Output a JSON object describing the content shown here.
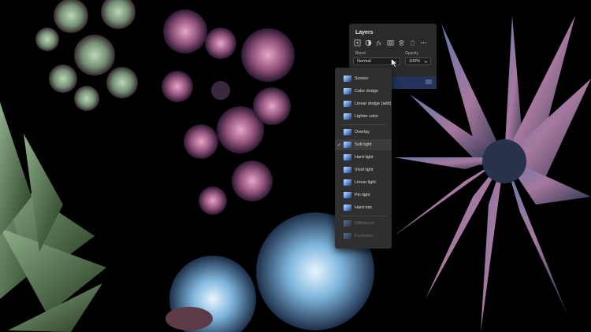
{
  "panel": {
    "title": "Layers",
    "blend_label": "Blend",
    "blend_value": "Normal",
    "opacity_label": "Opacity",
    "opacity_value": "100%",
    "toolbar_icons": [
      "add-layer-icon",
      "adjustment-icon",
      "fx-icon",
      "mask-icon",
      "layer-stack-icon",
      "delete-icon",
      "more-icon"
    ]
  },
  "blend_menu": {
    "items": [
      {
        "label": "Screen"
      },
      {
        "label": "Color dodge"
      },
      {
        "label": "Linear dodge (add)"
      },
      {
        "label": "Lighter color"
      },
      {
        "label": "Overlay"
      },
      {
        "label": "Soft light",
        "selected": true
      },
      {
        "label": "Hard light"
      },
      {
        "label": "Vivid light"
      },
      {
        "label": "Linear light"
      },
      {
        "label": "Pin light"
      },
      {
        "label": "Hard mix"
      },
      {
        "label": "Difference"
      },
      {
        "label": "Exclusion"
      }
    ],
    "check_mark": "✓"
  },
  "colors": {
    "panel_bg": "#2a2a2a",
    "menu_bg": "#2f2f2f",
    "selected_layer": "#23335a",
    "accent": "#5b8fd8"
  }
}
